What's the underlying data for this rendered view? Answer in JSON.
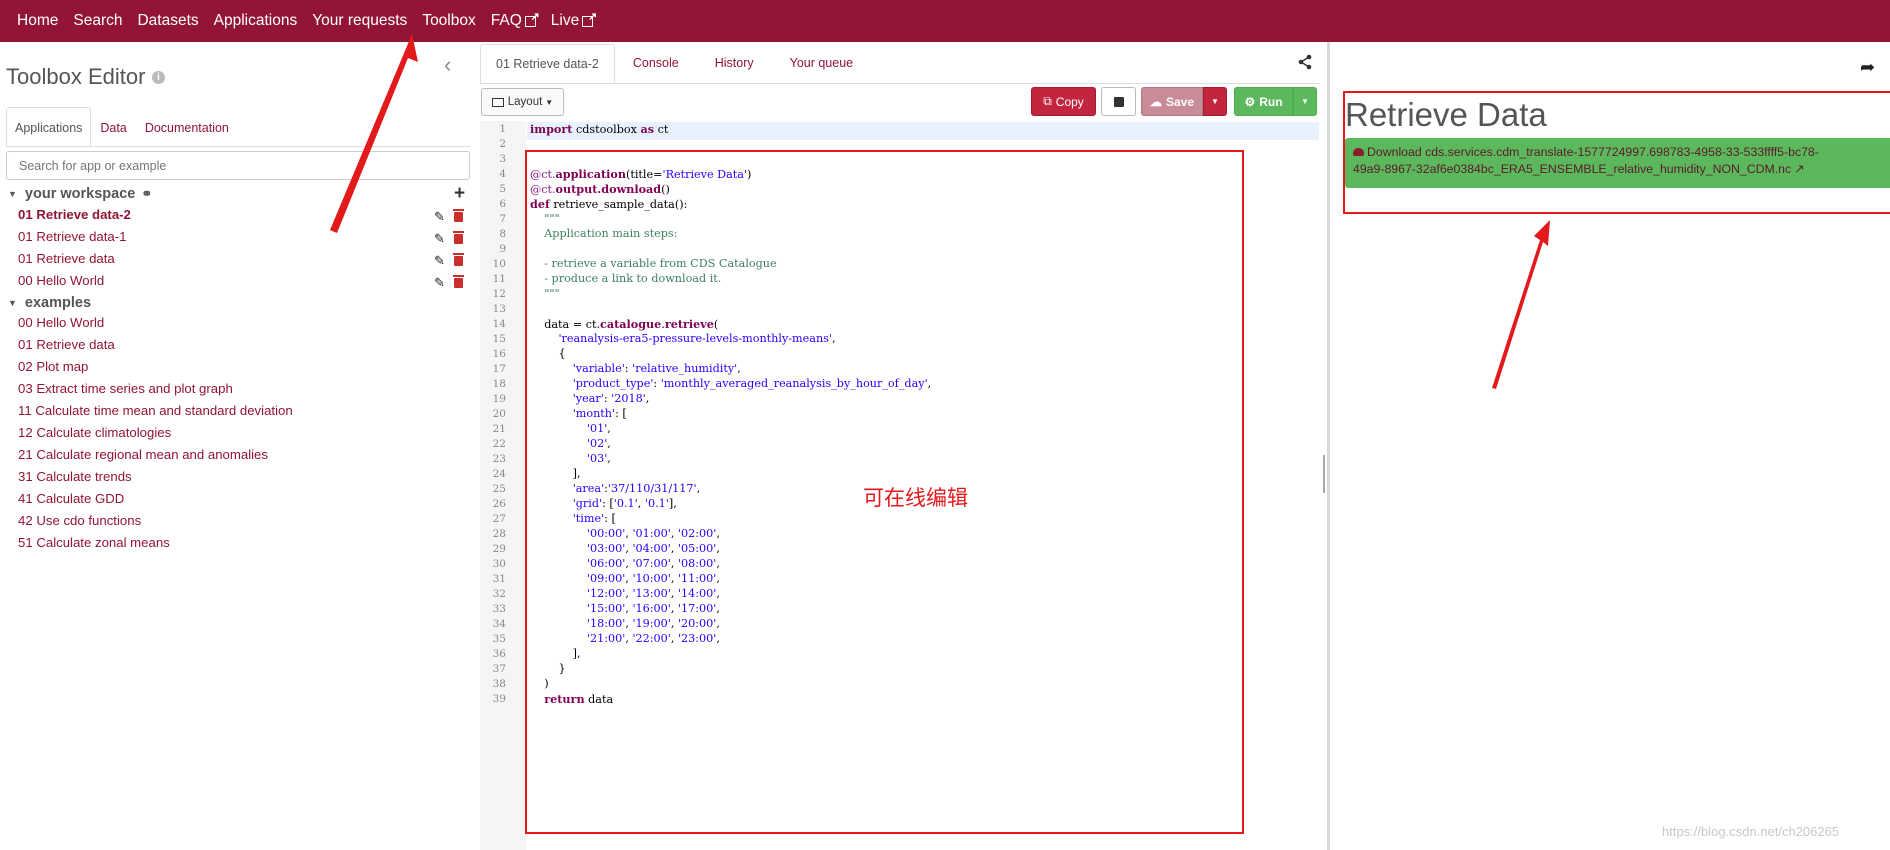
{
  "nav": {
    "items": [
      "Home",
      "Search",
      "Datasets",
      "Applications",
      "Your requests",
      "Toolbox",
      "FAQ",
      "Live"
    ]
  },
  "left": {
    "title": "Toolbox Editor",
    "tabs": [
      "Applications",
      "Data",
      "Documentation"
    ],
    "search_placeholder": "Search for app or example",
    "workspace_label": "your workspace",
    "workspace_items": [
      "01 Retrieve data-2",
      "01 Retrieve data-1",
      "01 Retrieve data",
      "00 Hello World"
    ],
    "examples_label": "examples",
    "example_items": [
      "00 Hello World",
      "01 Retrieve data",
      "02 Plot map",
      "03 Extract time series and plot graph",
      "11 Calculate time mean and standard deviation",
      "12 Calculate climatologies",
      "21 Calculate regional mean and anomalies",
      "31 Calculate trends",
      "41 Calculate GDD",
      "42 Use cdo functions",
      "51 Calculate zonal means"
    ]
  },
  "middle": {
    "tabs": [
      "01 Retrieve data-2",
      "Console",
      "History",
      "Your queue"
    ],
    "layout_label": "Layout",
    "copy_label": "Copy",
    "save_label": "Save",
    "run_label": "Run",
    "note": "可在线编辑",
    "code_lines": [
      "import cdstoolbox as ct",
      "",
      "",
      "@ct.application(title='Retrieve Data')",
      "@ct.output.download()",
      "def retrieve_sample_data():",
      "    \"\"\"",
      "    Application main steps:",
      "",
      "    - retrieve a variable from CDS Catalogue",
      "    - produce a link to download it.",
      "    \"\"\"",
      "",
      "    data = ct.catalogue.retrieve(",
      "        'reanalysis-era5-pressure-levels-monthly-means',",
      "        {",
      "            'variable': 'relative_humidity',",
      "            'product_type': 'monthly_averaged_reanalysis_by_hour_of_day',",
      "            'year': '2018',",
      "            'month': [",
      "                '01',",
      "                '02',",
      "                '03',",
      "            ],",
      "            'area':'37/110/31/117',",
      "            'grid': ['0.1', '0.1'],",
      "            'time': [",
      "                '00:00', '01:00', '02:00',",
      "                '03:00', '04:00', '05:00',",
      "                '06:00', '07:00', '08:00',",
      "                '09:00', '10:00', '11:00',",
      "                '12:00', '13:00', '14:00',",
      "                '15:00', '16:00', '17:00',",
      "                '18:00', '19:00', '20:00',",
      "                '21:00', '22:00', '23:00',",
      "            ],",
      "        }",
      "    )",
      "    return data"
    ]
  },
  "right": {
    "title": "Retrieve Data",
    "download_line1": "Download cds.services.cdm_translate-1577724997.698783-4958-33-533ffff5-bc78-",
    "download_line2": "49a9-8967-32af6e0384bc_ERA5_ENSEMBLE_relative_humidity_NON_CDM.nc"
  },
  "watermark": "https://blog.csdn.net/ch206265",
  "colors": {
    "brand": "#921535",
    "success": "#5cb85c",
    "annotation": "#e31a1c"
  }
}
